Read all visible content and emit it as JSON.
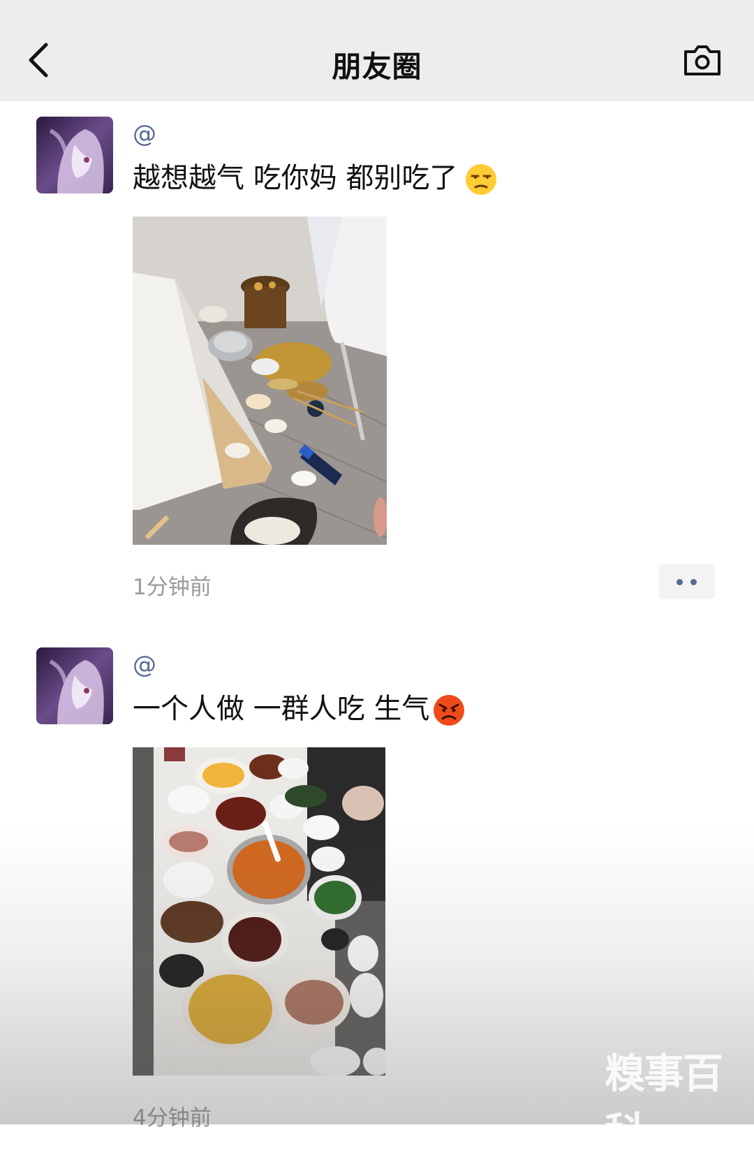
{
  "navbar": {
    "title": "朋友圈",
    "back_icon": "chevron-left-icon",
    "camera_icon": "camera-icon"
  },
  "posts": [
    {
      "username": "@",
      "text": "越想越气 吃你妈 都别吃了",
      "emoji": "unamused-face",
      "photo": "messy dinner table on floor",
      "time": "1分钟前",
      "more_icon": "more-dots-icon"
    },
    {
      "username": "@",
      "text": "一个人做 一群人吃 生气",
      "emoji": "angry-face",
      "photo": "full dinner table",
      "time": "4分钟前"
    }
  ],
  "watermark": "糗事百科",
  "colors": {
    "navbar_bg": "#ededed",
    "username": "#576b95",
    "timestamp": "#9a9a9a"
  }
}
